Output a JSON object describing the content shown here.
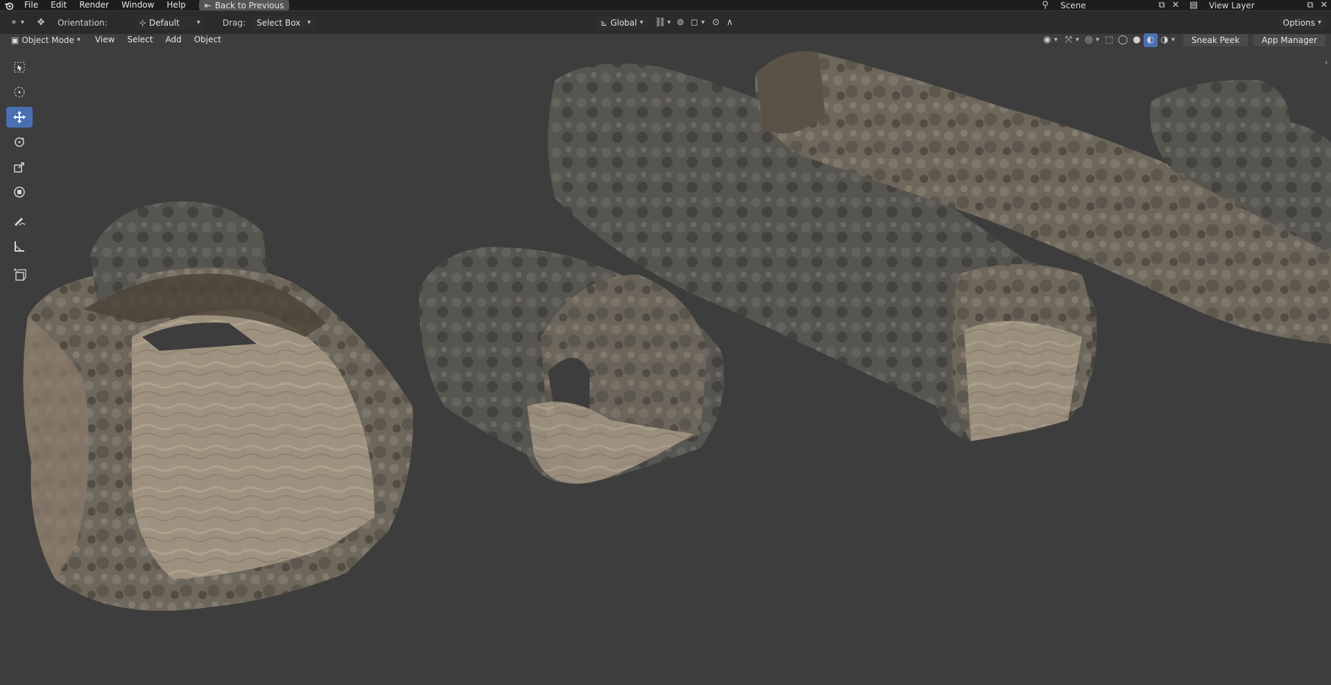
{
  "menubar": {
    "items": [
      "File",
      "Edit",
      "Render",
      "Window",
      "Help"
    ],
    "back_button": "Back to Previous",
    "scene_name": "Scene",
    "view_layer": "View Layer"
  },
  "tool_header": {
    "orientation_label": "Orientation:",
    "orientation_value": "Default",
    "drag_label": "Drag:",
    "drag_value": "Select Box",
    "transform_space": "Global",
    "options_label": "Options"
  },
  "view_header": {
    "mode": "Object Mode",
    "menus": [
      "View",
      "Select",
      "Add",
      "Object"
    ],
    "sneak_peek": "Sneak Peek",
    "app_manager": "App Manager"
  },
  "toolbar": {
    "tools": [
      "select-box-icon",
      "cursor-icon",
      "move-icon",
      "rotate-icon",
      "scale-icon",
      "transform-icon",
      "annotate-icon",
      "measure-icon",
      "add-cube-icon"
    ],
    "active_tool": "move-icon"
  },
  "colors": {
    "viewport_bg": "#3d3d3d",
    "header_bg": "#2b2b2b",
    "topbar_bg": "#1d1d1d",
    "accent": "#4b6fb3"
  }
}
